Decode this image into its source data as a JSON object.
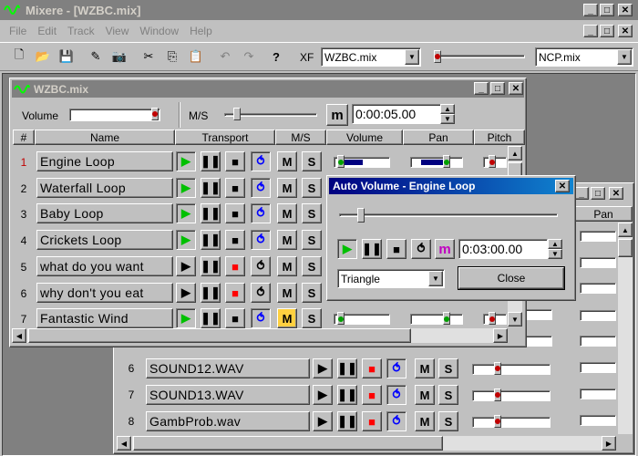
{
  "app": {
    "title": "Mixere - [WZBC.mix]",
    "menu": [
      "File",
      "Edit",
      "Track",
      "View",
      "Window",
      "Help"
    ],
    "toolbar": {
      "xf_label": "XF",
      "mix_combo": "WZBC.mix",
      "ncp_combo": "NCP.mix"
    }
  },
  "win_back": {
    "pan_header": "Pan",
    "rows": [
      {
        "num": "6",
        "name": "SOUND12.WAV"
      },
      {
        "num": "7",
        "name": "SOUND13.WAV"
      },
      {
        "num": "8",
        "name": "GambProb.wav"
      }
    ]
  },
  "win_main": {
    "title": "WZBC.mix",
    "volume_label": "Volume",
    "ms_label": "M/S",
    "m_button": "m",
    "time_value": "0:00:05.00",
    "headers": [
      "#",
      "Name",
      "Transport",
      "M/S",
      "Volume",
      "Pan",
      "Pitch"
    ],
    "rows": [
      {
        "num": "1",
        "name": "Engine Loop",
        "m": "M",
        "s": "S"
      },
      {
        "num": "2",
        "name": "Waterfall Loop",
        "m": "M",
        "s": "S"
      },
      {
        "num": "3",
        "name": "Baby Loop",
        "m": "M",
        "s": "S"
      },
      {
        "num": "4",
        "name": "Crickets Loop",
        "m": "M",
        "s": "S"
      },
      {
        "num": "5",
        "name": "what do you want",
        "m": "M",
        "s": "S"
      },
      {
        "num": "6",
        "name": "why don't you eat",
        "m": "M",
        "s": "S"
      },
      {
        "num": "7",
        "name": "Fantastic Wind",
        "m": "M",
        "s": "S"
      }
    ]
  },
  "auto_volume": {
    "title": "Auto Volume - Engine Loop",
    "m_button": "m",
    "time_value": "0:03:00.00",
    "waveform": "Triangle",
    "close_label": "Close"
  },
  "colors": {
    "play_green": "#00c000",
    "stop_red": "#ff0000",
    "loop_blue": "#0000ff",
    "mute_yellow": "#ffd040",
    "m_magenta": "#c000c0",
    "titlebar_active": "#000080",
    "titlebar_inactive": "#808080"
  }
}
